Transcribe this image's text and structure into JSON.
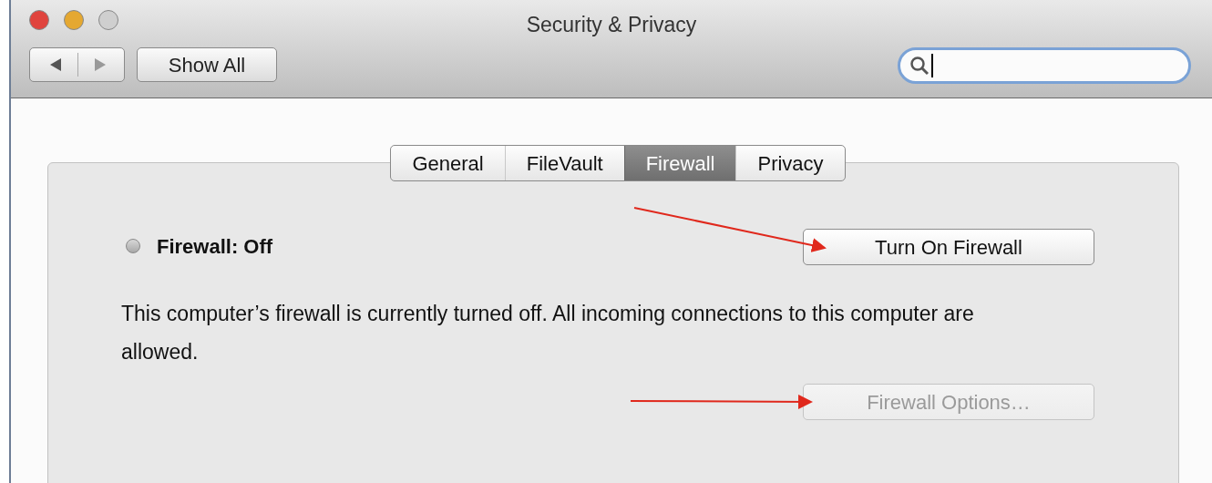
{
  "window": {
    "title": "Security & Privacy",
    "controls": [
      {
        "color": "#e0443e"
      },
      {
        "color": "#e5a831"
      },
      {
        "color": "#cfcfcf"
      }
    ]
  },
  "toolbar": {
    "show_all_button": "Show All",
    "search": {
      "focused": true
    }
  },
  "tabs": [
    {
      "label": "General",
      "selected": false
    },
    {
      "label": "FileVault",
      "selected": false
    },
    {
      "label": "Firewall",
      "selected": true
    },
    {
      "label": "Privacy",
      "selected": false
    }
  ],
  "firewall": {
    "status": "Firewall: Off",
    "on": false,
    "turn_on_button": {
      "label": "Turn On Firewall",
      "disabled": false
    },
    "description": "This computer’s firewall is currently turned off. All incoming connections to this computer are allowed.",
    "options_button": {
      "label": "Firewall Options…",
      "disabled": true
    }
  }
}
